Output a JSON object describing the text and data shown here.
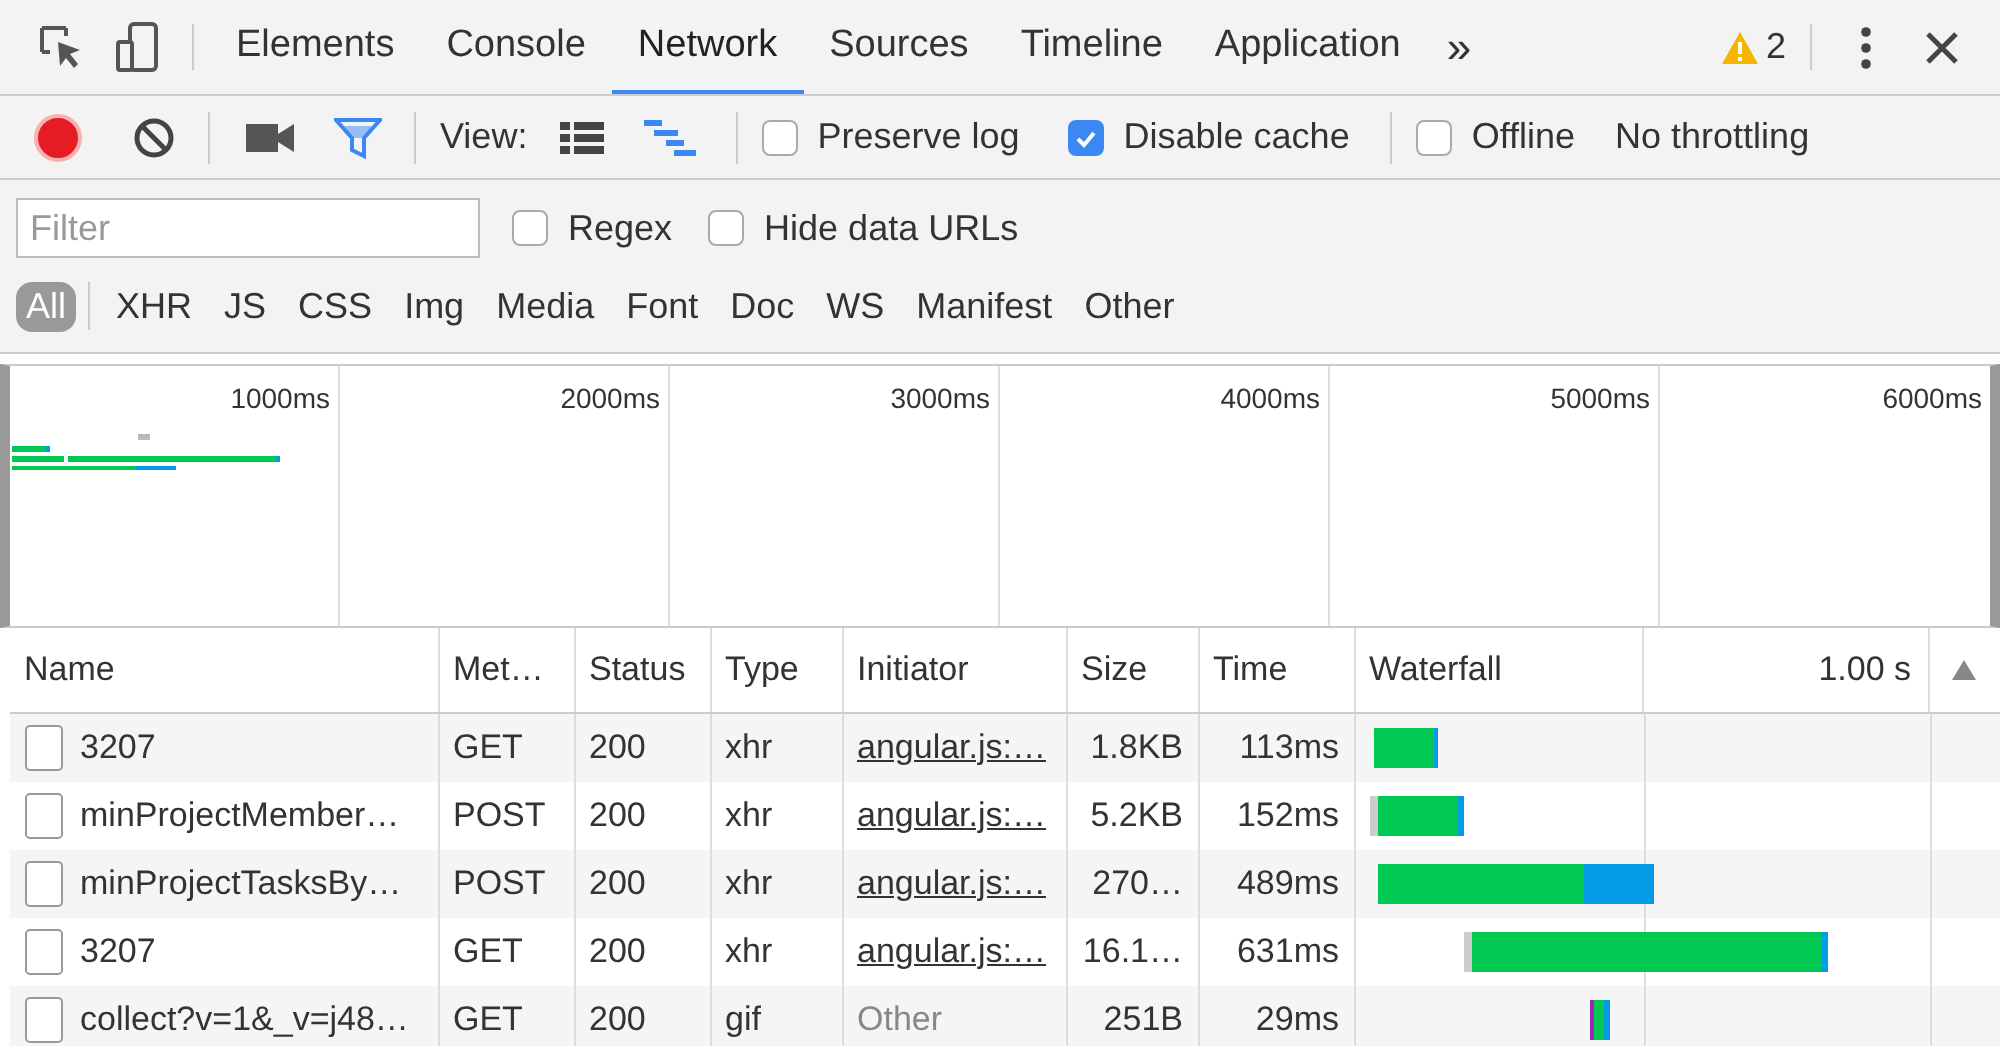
{
  "tabs": [
    {
      "label": "Elements",
      "selected": false
    },
    {
      "label": "Console",
      "selected": false
    },
    {
      "label": "Network",
      "selected": true
    },
    {
      "label": "Sources",
      "selected": false
    },
    {
      "label": "Timeline",
      "selected": false
    },
    {
      "label": "Application",
      "selected": false
    }
  ],
  "more_tabs": "»",
  "warnings": {
    "count": "2"
  },
  "toolbar": {
    "recording": true,
    "filter_shown": true,
    "view_label": "View:",
    "overview_shown": true,
    "options": [
      {
        "label": "Preserve log",
        "checked": false
      },
      {
        "label": "Disable cache",
        "checked": true
      },
      {
        "label": "Offline",
        "checked": false
      }
    ],
    "throttling": "No throttling"
  },
  "filter": {
    "placeholder": "Filter",
    "options": [
      {
        "label": "Regex",
        "checked": false
      },
      {
        "label": "Hide data URLs",
        "checked": false
      }
    ],
    "types": [
      {
        "label": "All",
        "selected": true
      },
      {
        "label": "XHR",
        "selected": false
      },
      {
        "label": "JS",
        "selected": false
      },
      {
        "label": "CSS",
        "selected": false
      },
      {
        "label": "Img",
        "selected": false
      },
      {
        "label": "Media",
        "selected": false
      },
      {
        "label": "Font",
        "selected": false
      },
      {
        "label": "Doc",
        "selected": false
      },
      {
        "label": "WS",
        "selected": false
      },
      {
        "label": "Manifest",
        "selected": false
      },
      {
        "label": "Other",
        "selected": false
      }
    ]
  },
  "overview": {
    "ticks": [
      "1000ms",
      "2000ms",
      "3000ms",
      "4000ms",
      "5000ms",
      "6000ms"
    ]
  },
  "table": {
    "columns": [
      "Name",
      "Met…",
      "Status",
      "Type",
      "Initiator",
      "Size",
      "Time",
      "Waterfall"
    ],
    "waterfall_scale": "1.00 s",
    "rows": [
      {
        "name": "3207",
        "method": "GET",
        "status": "200",
        "type": "xhr",
        "initiator": "angular.js:…",
        "initiator_is_link": true,
        "size": "1.8KB",
        "time": "113ms"
      },
      {
        "name": "minProjectMember…",
        "method": "POST",
        "status": "200",
        "type": "xhr",
        "initiator": "angular.js:…",
        "initiator_is_link": true,
        "size": "5.2KB",
        "time": "152ms"
      },
      {
        "name": "minProjectTasksBy…",
        "method": "POST",
        "status": "200",
        "type": "xhr",
        "initiator": "angular.js:…",
        "initiator_is_link": true,
        "size": "270…",
        "time": "489ms"
      },
      {
        "name": "3207",
        "method": "GET",
        "status": "200",
        "type": "xhr",
        "initiator": "angular.js:…",
        "initiator_is_link": true,
        "size": "16.1…",
        "time": "631ms"
      },
      {
        "name": "collect?v=1&_v=j48…",
        "method": "GET",
        "status": "200",
        "type": "gif",
        "initiator": "Other",
        "initiator_is_link": false,
        "size": "251B",
        "time": "29ms"
      }
    ]
  }
}
